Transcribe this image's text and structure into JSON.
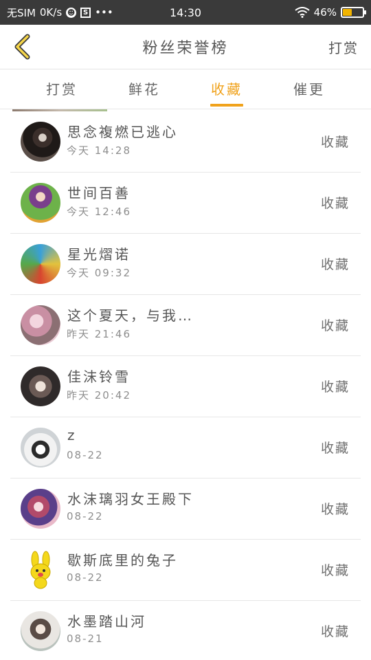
{
  "status_bar": {
    "carrier": "无SIM",
    "speed": "0K/s",
    "time": "14:30",
    "battery": "46%",
    "battery_level": 0.46,
    "icons": [
      "ghost-icon",
      "s-app-icon",
      "more-dots-icon",
      "wifi-icon",
      "battery-icon"
    ],
    "more": "•••"
  },
  "header": {
    "title": "粉丝荣誉榜",
    "action": "打赏",
    "back_icon": "chevron-left-icon"
  },
  "tabs": [
    {
      "label": "打赏",
      "active": false
    },
    {
      "label": "鲜花",
      "active": false
    },
    {
      "label": "收藏",
      "active": true
    },
    {
      "label": "催更",
      "active": false
    }
  ],
  "accent_color": "#f0a21b",
  "list": [
    {
      "name": "思念複燃已逃心",
      "time": "今天 14:28",
      "action": "收藏"
    },
    {
      "name": "世间百善",
      "time": "今天 12:46",
      "action": "收藏"
    },
    {
      "name": "星光熠诺",
      "time": "今天 09:32",
      "action": "收藏"
    },
    {
      "name": "这个夏天，与我…",
      "time": "昨天 21:46",
      "action": "收藏"
    },
    {
      "name": "佳沫铃雪",
      "time": "昨天 20:42",
      "action": "收藏"
    },
    {
      "name": "z",
      "time": "08-22",
      "action": "收藏"
    },
    {
      "name": "水沫璃羽女王殿下",
      "time": "08-22",
      "action": "收藏"
    },
    {
      "name": "歇斯底里的兔子",
      "time": "08-22",
      "action": "收藏"
    },
    {
      "name": "水墨踏山河",
      "time": "08-21",
      "action": "收藏"
    }
  ]
}
